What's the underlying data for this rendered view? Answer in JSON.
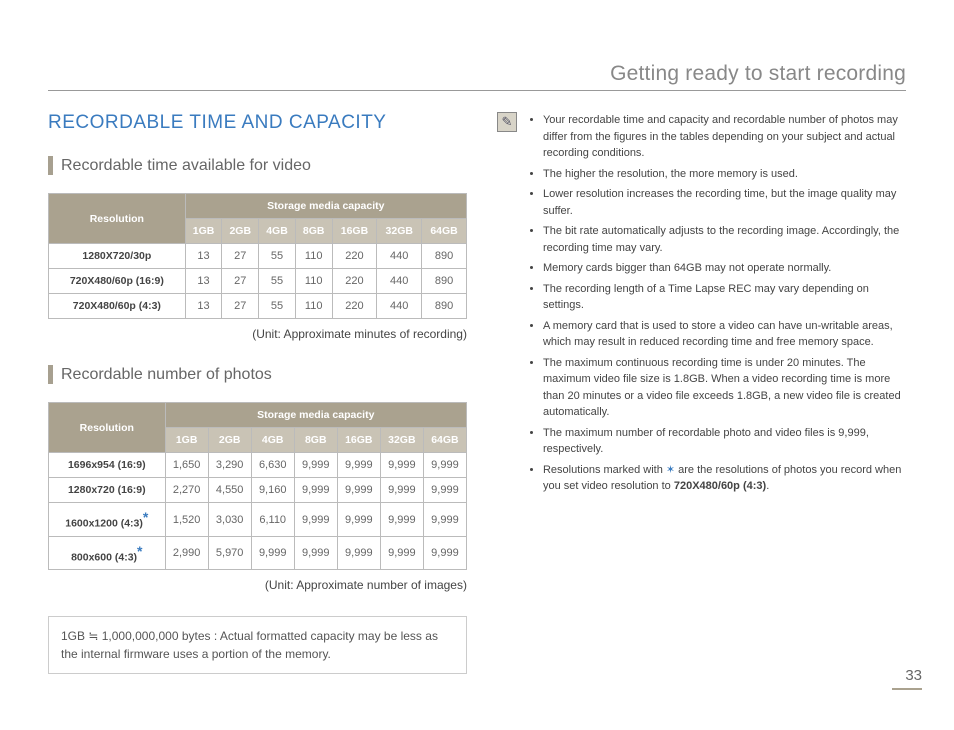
{
  "header": {
    "title": "Getting ready to start recording"
  },
  "main_title": "RECORDABLE TIME AND CAPACITY",
  "section1": {
    "title": "Recordable time available for video",
    "unit": "(Unit: Approximate minutes of recording)"
  },
  "section2": {
    "title": "Recordable number of photos",
    "unit": "(Unit: Approximate number of images)"
  },
  "table_headers": {
    "resolution": "Resolution",
    "storage": "Storage media capacity",
    "cols": [
      "1GB",
      "2GB",
      "4GB",
      "8GB",
      "16GB",
      "32GB",
      "64GB"
    ]
  },
  "video_rows": [
    {
      "label": "1280X720/30p",
      "v": [
        "13",
        "27",
        "55",
        "110",
        "220",
        "440",
        "890"
      ]
    },
    {
      "label": "720X480/60p (16:9)",
      "v": [
        "13",
        "27",
        "55",
        "110",
        "220",
        "440",
        "890"
      ]
    },
    {
      "label": "720X480/60p (4:3)",
      "v": [
        "13",
        "27",
        "55",
        "110",
        "220",
        "440",
        "890"
      ]
    }
  ],
  "photo_rows": [
    {
      "label": "1696x954 (16:9)",
      "star": false,
      "v": [
        "1,650",
        "3,290",
        "6,630",
        "9,999",
        "9,999",
        "9,999",
        "9,999"
      ]
    },
    {
      "label": "1280x720 (16:9)",
      "star": false,
      "v": [
        "2,270",
        "4,550",
        "9,160",
        "9,999",
        "9,999",
        "9,999",
        "9,999"
      ]
    },
    {
      "label": "1600x1200 (4:3)",
      "star": true,
      "v": [
        "1,520",
        "3,030",
        "6,110",
        "9,999",
        "9,999",
        "9,999",
        "9,999"
      ]
    },
    {
      "label": "800x600 (4:3)",
      "star": true,
      "v": [
        "2,990",
        "5,970",
        "9,999",
        "9,999",
        "9,999",
        "9,999",
        "9,999"
      ]
    }
  ],
  "footnote": "1GB ≒ 1,000,000,000 bytes : Actual formatted capacity may be less as the internal firmware uses a portion of the memory.",
  "notes": [
    "Your recordable time and capacity and recordable number of photos may differ from the figures in the tables depending on your subject and actual recording conditions.",
    "The higher the resolution, the more memory is used.",
    "Lower resolution increases the recording time, but the image quality may suffer.",
    "The bit rate automatically adjusts to the recording image. Accordingly, the recording time may vary.",
    "Memory cards bigger than 64GB may not operate normally.",
    "The recording length of a Time Lapse REC may vary depending on settings.",
    "A memory card that is used to store a video can have un-writable areas, which may result in reduced recording time and free memory space.",
    "The maximum continuous recording time is under 20 minutes. The maximum video file size is 1.8GB. When a video recording time is more than 20 minutes or a video file exceeds 1.8GB, a new video file is created automatically.",
    "The maximum number of recordable photo and video files is 9,999, respectively."
  ],
  "note_star_prefix": "Resolutions marked with ",
  "note_star_suffix": " are the resolutions of photos you record when you set video resolution to ",
  "note_star_bold": "720X480/60p (4:3)",
  "page_number": "33"
}
